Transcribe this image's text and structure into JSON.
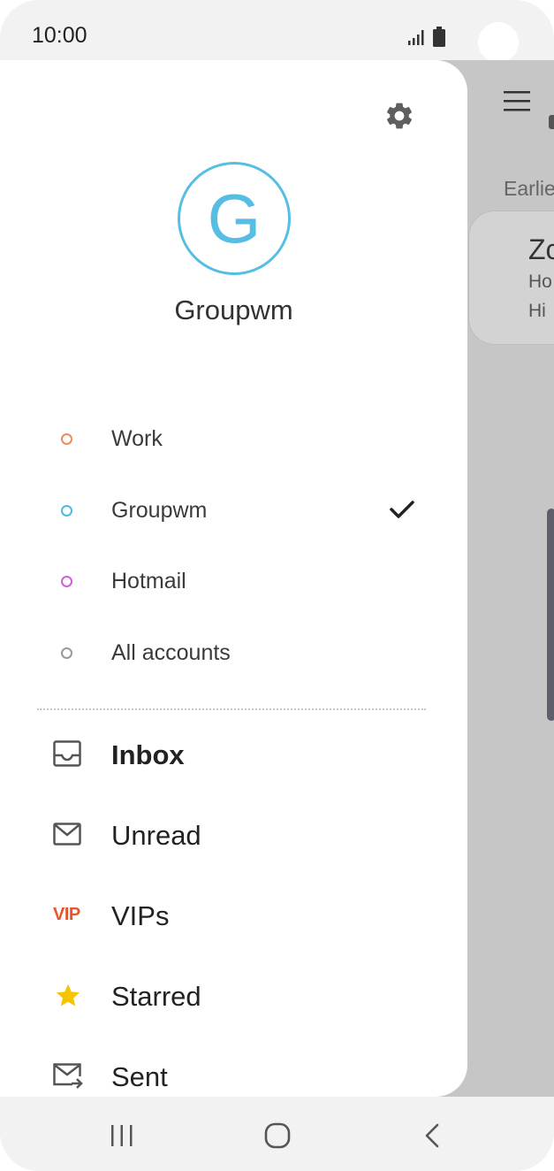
{
  "status_bar": {
    "time": "10:00"
  },
  "background_app": {
    "section_label": "Earlie",
    "card": {
      "sender": "Zc",
      "line1": "Ho",
      "line2": "Hi"
    }
  },
  "drawer": {
    "account_initial": "G",
    "account_name": "Groupwm",
    "accounts": [
      {
        "label": "Work",
        "color": "#ef8a5a",
        "selected": false
      },
      {
        "label": "Groupwm",
        "color": "#4fb8e2",
        "selected": true
      },
      {
        "label": "Hotmail",
        "color": "#cf5dd8",
        "selected": false
      },
      {
        "label": "All accounts",
        "color": "#9a9a9a",
        "selected": false
      }
    ],
    "folders": [
      {
        "label": "Inbox",
        "icon": "inbox-icon",
        "bold": true
      },
      {
        "label": "Unread",
        "icon": "mail-icon",
        "bold": false
      },
      {
        "label": "VIPs",
        "icon": "vip-icon",
        "badge": "VIP",
        "bold": false
      },
      {
        "label": "Starred",
        "icon": "star-icon",
        "bold": false
      },
      {
        "label": "Sent",
        "icon": "sent-icon",
        "bold": false
      }
    ]
  },
  "colors": {
    "accent": "#56bde3",
    "vip": "#e8522c",
    "star": "#f6c400"
  }
}
